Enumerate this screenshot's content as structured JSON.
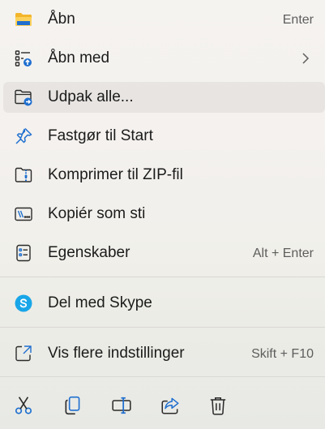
{
  "menu": {
    "items": [
      {
        "label": "Åbn",
        "shortcut": "Enter",
        "icon": "folder-icon"
      },
      {
        "label": "Åbn med",
        "shortcut": "",
        "icon": "open-with-icon",
        "submenu": true
      },
      {
        "label": "Udpak alle...",
        "shortcut": "",
        "icon": "extract-folder-icon"
      },
      {
        "label": "Fastgør til Start",
        "shortcut": "",
        "icon": "pin-icon"
      },
      {
        "label": "Komprimer til ZIP-fil",
        "shortcut": "",
        "icon": "zip-icon"
      },
      {
        "label": "Kopiér som sti",
        "shortcut": "",
        "icon": "copy-path-icon"
      },
      {
        "label": "Egenskaber",
        "shortcut": "Alt + Enter",
        "icon": "properties-icon"
      },
      {
        "label": "Del med Skype",
        "shortcut": "",
        "icon": "skype-icon"
      },
      {
        "label": "Vis flere indstillinger",
        "shortcut": "Skift + F10",
        "icon": "more-options-icon"
      }
    ]
  },
  "toolbar": {
    "buttons": [
      {
        "icon": "cut-icon"
      },
      {
        "icon": "copy-icon"
      },
      {
        "icon": "rename-icon"
      },
      {
        "icon": "share-icon"
      },
      {
        "icon": "delete-icon"
      }
    ]
  },
  "colors": {
    "accent": "#1f6fcf",
    "folder_yellow": "#f4c542",
    "skype_blue": "#19a6e8",
    "text": "#1b1b1b",
    "muted": "#5d5d5d"
  }
}
